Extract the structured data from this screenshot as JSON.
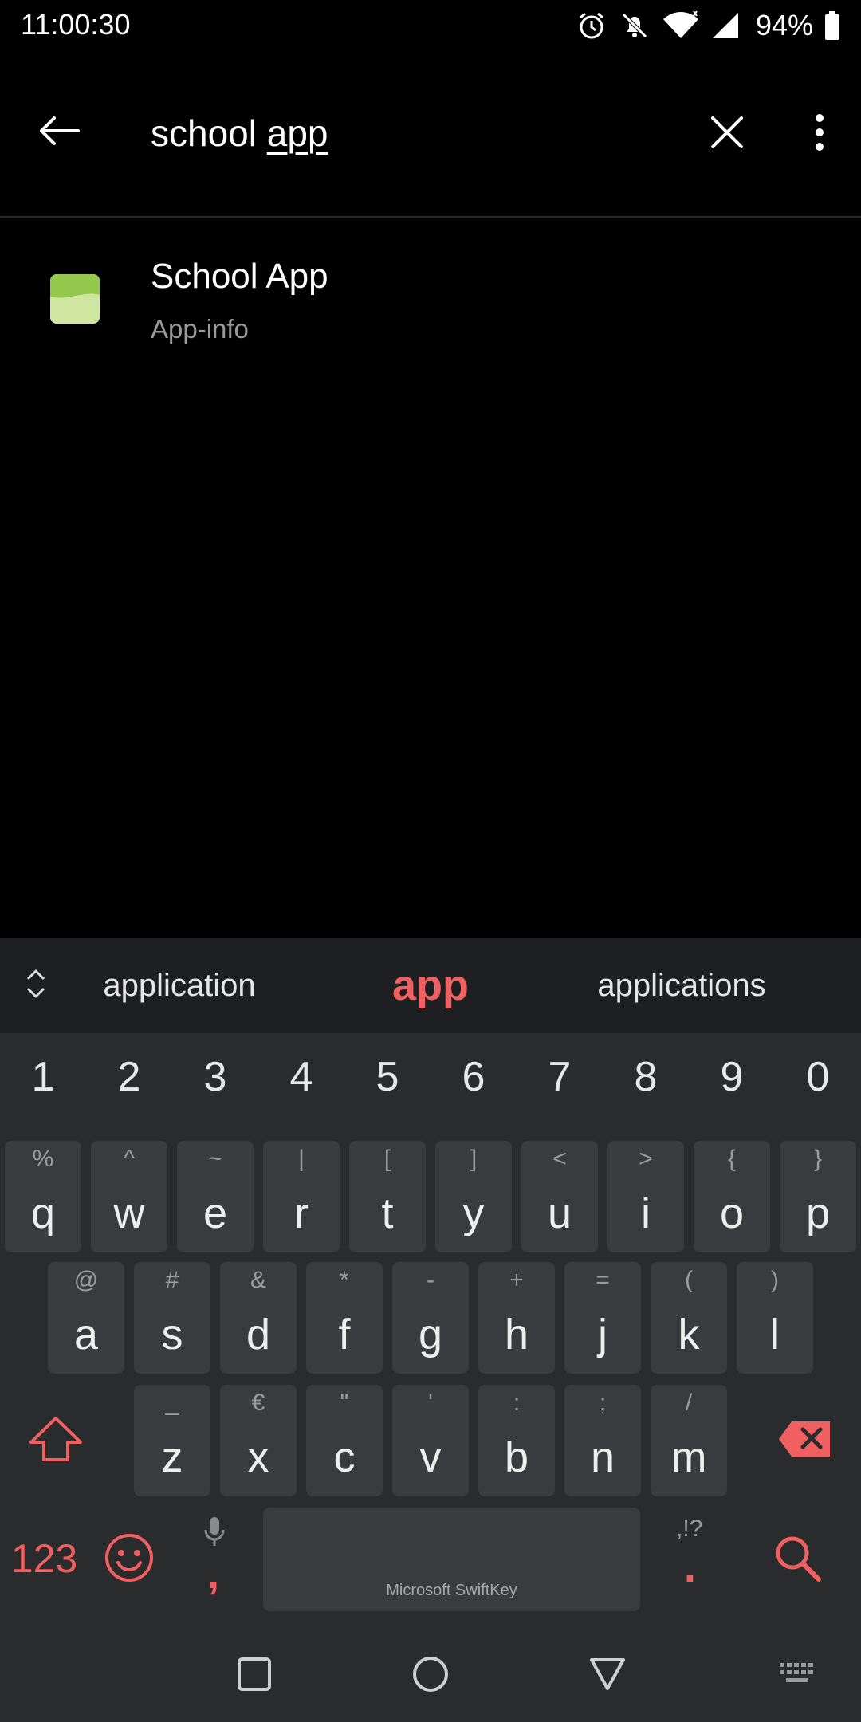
{
  "status_bar": {
    "time": "11:00:30",
    "battery_percent": "94%",
    "icons": [
      "alarm-icon",
      "notifications-off-icon",
      "wifi-icon",
      "cell-signal-icon",
      "battery-icon"
    ]
  },
  "search": {
    "query_prefix": "school ",
    "query_composing": "app",
    "back_icon": "arrow-left-icon",
    "clear_icon": "close-icon",
    "more_icon": "more-vert-icon"
  },
  "results": [
    {
      "title": "School App",
      "subtitle": "App-info",
      "icon": "app-icon"
    }
  ],
  "keyboard": {
    "suggestions": [
      "application",
      "app",
      "applications"
    ],
    "numbers": [
      "1",
      "2",
      "3",
      "4",
      "5",
      "6",
      "7",
      "8",
      "9",
      "0"
    ],
    "row1": [
      {
        "pri": "q",
        "sec": "%"
      },
      {
        "pri": "w",
        "sec": "^"
      },
      {
        "pri": "e",
        "sec": "~"
      },
      {
        "pri": "r",
        "sec": "|"
      },
      {
        "pri": "t",
        "sec": "["
      },
      {
        "pri": "y",
        "sec": "]"
      },
      {
        "pri": "u",
        "sec": "<"
      },
      {
        "pri": "i",
        "sec": ">"
      },
      {
        "pri": "o",
        "sec": "{"
      },
      {
        "pri": "p",
        "sec": "}"
      }
    ],
    "row2": [
      {
        "pri": "a",
        "sec": "@"
      },
      {
        "pri": "s",
        "sec": "#"
      },
      {
        "pri": "d",
        "sec": "&"
      },
      {
        "pri": "f",
        "sec": "*"
      },
      {
        "pri": "g",
        "sec": "-"
      },
      {
        "pri": "h",
        "sec": "+"
      },
      {
        "pri": "j",
        "sec": "="
      },
      {
        "pri": "k",
        "sec": "("
      },
      {
        "pri": "l",
        "sec": ")"
      }
    ],
    "row3": [
      {
        "pri": "z",
        "sec": "_"
      },
      {
        "pri": "x",
        "sec": "€"
      },
      {
        "pri": "c",
        "sec": "\""
      },
      {
        "pri": "v",
        "sec": "'"
      },
      {
        "pri": "b",
        "sec": ":"
      },
      {
        "pri": "n",
        "sec": ";"
      },
      {
        "pri": "m",
        "sec": "/"
      }
    ],
    "mode_label": "123",
    "space_label": "Microsoft SwiftKey",
    "comma": ",",
    "period": ".",
    "punct_hint": ",!?",
    "accent_color": "#f06060"
  },
  "nav": {
    "buttons": [
      "recents-icon",
      "home-icon",
      "back-triangle-icon",
      "keyboard-icon"
    ]
  }
}
